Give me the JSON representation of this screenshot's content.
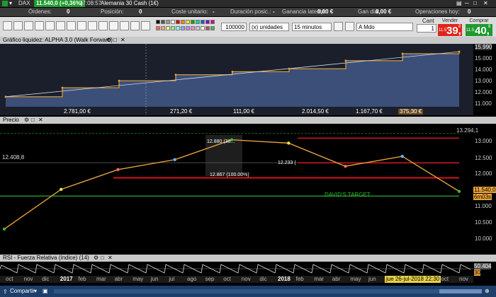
{
  "title": "DAX",
  "top": {
    "instrument": "Alemania 30 Cash (1€)",
    "price": "11.540,0 (+0,36%)",
    "time": "17:08:57"
  },
  "stats": [
    {
      "label": "Órdenes:",
      "value": "0"
    },
    {
      "label": "Posición:",
      "value": "0"
    },
    {
      "label": "Coste unitario:",
      "value": "-"
    },
    {
      "label": "Duración posic.:",
      "value": "-"
    },
    {
      "label": "Ganancia latente:",
      "value": "0,00 €"
    },
    {
      "label": "Gan día:",
      "value": "0,00 €"
    },
    {
      "label": "Operaciones hoy:",
      "value": "0"
    }
  ],
  "toolbar": {
    "units_value": "100000",
    "units_mode": "(x) unidades",
    "timeframe": "15 minutos",
    "order_type": "A Mdo",
    "qty_label": "Cant",
    "qty_value": "1",
    "sell_label": "Vender",
    "sell_small": "11.5",
    "sell_big": "39,",
    "sell_sup": "8",
    "buy_label": "Comprar",
    "buy_small": "11.5",
    "buy_big": "40,",
    "buy_sup": "8"
  },
  "equity_panel": {
    "title": "Gráfico liquidez: ALPHA 3.0 (Walk Forward)",
    "bottom_labels": [
      "2.781,00 €",
      "271,20 €",
      "111,00 €",
      "2.014,50 €",
      "1.167,70 €",
      "375,30 €"
    ],
    "y_labels": [
      "15.990",
      "15.000",
      "14.000",
      "13.000",
      "12.000",
      "11.000"
    ]
  },
  "price_panel": {
    "title": "Precio",
    "y_labels": [
      "13.294,1",
      "13.000",
      "12.500",
      "12.000",
      "11.540,0",
      "11.000",
      "10.500",
      "10.000"
    ],
    "current_price": "11.540,0",
    "timer": "6m03s",
    "left_level": "12.408,8",
    "annotation": "DAVID'S TARGET",
    "fib_labels": [
      "12.880 (38...",
      "12.867 (100.00%)",
      "12.233 ("
    ],
    "level_labels": [
      "13.294,1"
    ]
  },
  "rsi_panel": {
    "title": "RSI - Fuerza Relativa (índice) (14)",
    "y_labels": [
      "50.404",
      "30"
    ]
  },
  "x_axis": [
    "oct",
    "nov",
    "dic",
    "2017",
    "feb",
    "mar",
    "abr",
    "may",
    "jun",
    "jul",
    "ago",
    "sep",
    "oct",
    "nov",
    "dic",
    "2018",
    "feb",
    "mar",
    "abr",
    "may",
    "jun",
    "jul",
    "ago",
    "sep",
    "oct",
    "nov"
  ],
  "cursor_time": "jue 26-jul-2018 22:30",
  "bottom_bar": {
    "share_label": "Compartir"
  },
  "colors": {
    "sell": "#e0251b",
    "buy": "#1f9a2e",
    "equity_fill": "#3b4f78",
    "equity_line": "#e8a23a",
    "support": "#d8141c",
    "target": "#2fbf2f"
  },
  "chart_data": {
    "type": "area",
    "title": "Gráfico liquidez: ALPHA 3.0 (Walk Forward)",
    "x": [
      "oct 2016",
      "jan 2017",
      "apr 2017",
      "jul 2017",
      "oct 2017",
      "jan 2018",
      "apr 2018",
      "jul 2018",
      "oct 2018"
    ],
    "series": [
      {
        "name": "equity",
        "values": [
          11000,
          11900,
          12600,
          13200,
          13500,
          13800,
          14600,
          15300,
          15500
        ]
      },
      {
        "name": "price",
        "values": [
          10400,
          11600,
          12200,
          12500,
          13100,
          13000,
          12300,
          12600,
          11540
        ]
      }
    ],
    "ylim": [
      10000,
      16000
    ]
  }
}
